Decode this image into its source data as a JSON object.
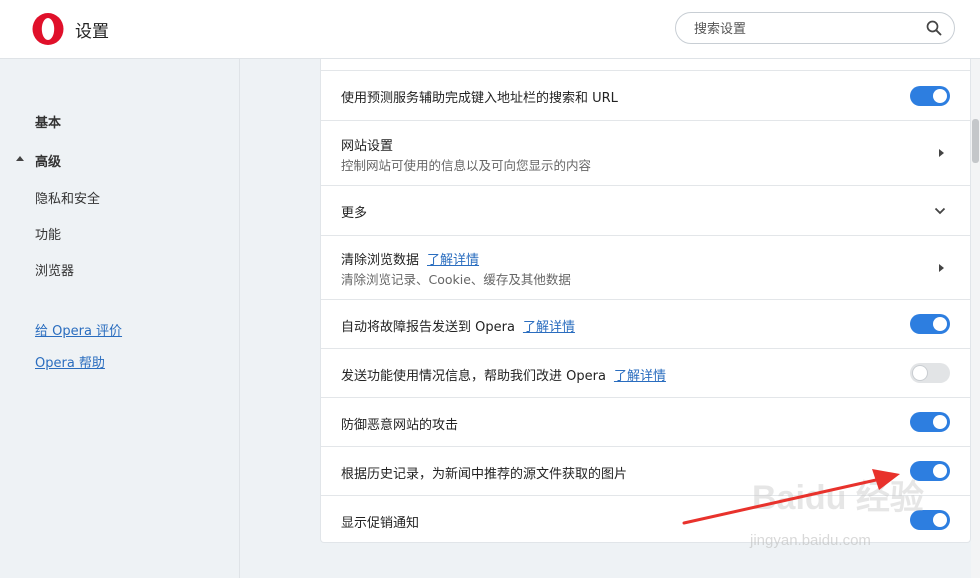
{
  "header": {
    "title": "设置",
    "search_placeholder": "搜索设置"
  },
  "sidebar": {
    "items": [
      {
        "label": "基本"
      },
      {
        "label": "高级"
      },
      {
        "label": "隐私和安全"
      },
      {
        "label": "功能"
      },
      {
        "label": "浏览器"
      }
    ],
    "links": [
      {
        "label": "给 Opera 评价"
      },
      {
        "label": "Opera 帮助"
      }
    ]
  },
  "settings": {
    "predict": {
      "title": "使用预测服务辅助完成键入地址栏的搜索和 URL",
      "enabled": true
    },
    "site_settings": {
      "title": "网站设置",
      "subtitle": "控制网站可使用的信息以及可向您显示的内容"
    },
    "more": {
      "title": "更多"
    },
    "clear_data": {
      "title": "清除浏览数据",
      "learn_more": "了解详情",
      "subtitle": "清除浏览记录、Cookie、缓存及其他数据"
    },
    "crash_report": {
      "title": "自动将故障报告发送到 Opera",
      "learn_more": "了解详情",
      "enabled": true
    },
    "usage_stats": {
      "title": "发送功能使用情况信息，帮助我们改进 Opera",
      "learn_more": "了解详情",
      "enabled": false
    },
    "malware": {
      "title": "防御恶意网站的攻击",
      "enabled": true
    },
    "news_images": {
      "title": "根据历史记录，为新闻中推荐的源文件获取的图片",
      "enabled": true
    },
    "promo": {
      "title": "显示促销通知",
      "enabled": true
    }
  },
  "watermark": {
    "brand": "Baidu 经验",
    "url": "jingyan.baidu.com"
  },
  "colors": {
    "accent": "#2d7ee0",
    "link": "#2a6dbf",
    "logo_red": "#e0102a",
    "annotation_red": "#e8322c"
  }
}
